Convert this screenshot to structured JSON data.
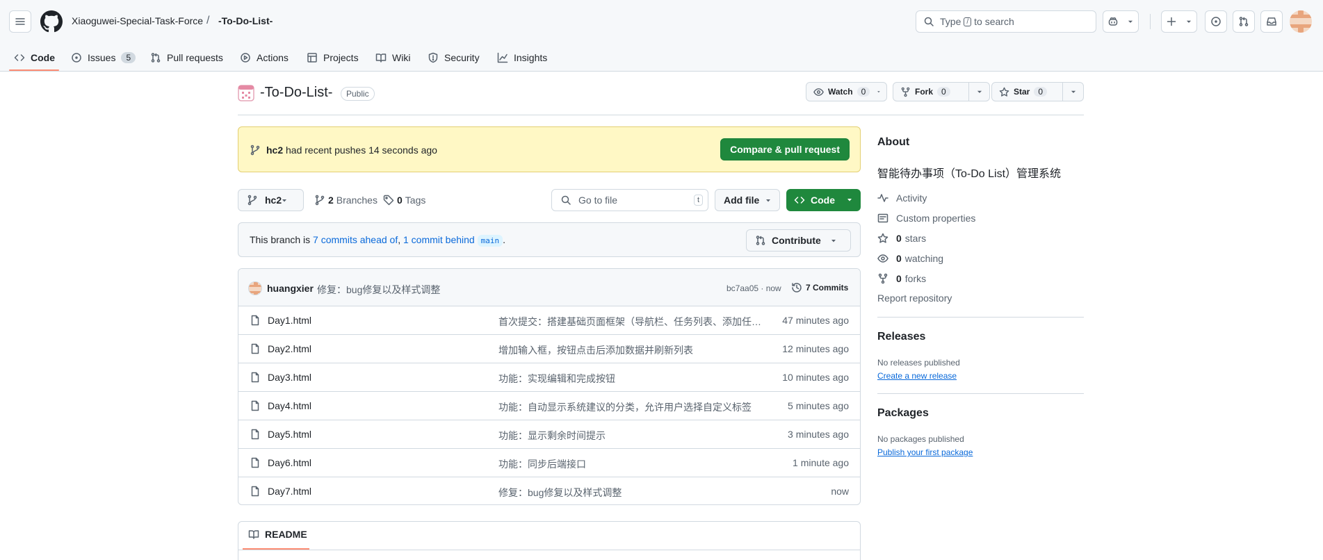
{
  "header": {
    "owner": "Xiaoguwei-Special-Task-Force",
    "separator": "/",
    "repo": "-To-Do-List-",
    "search_pre": "Type",
    "search_key": "/",
    "search_post": "to search",
    "icons": [
      "hamburger-icon",
      "github-logo",
      "search-icon",
      "copilot-icon",
      "plus-icon",
      "issue-icon",
      "pull-request-icon",
      "inbox-icon"
    ]
  },
  "tabs": [
    {
      "label": "Code",
      "icon": "code-icon"
    },
    {
      "label": "Issues",
      "icon": "issue-icon",
      "count": "5"
    },
    {
      "label": "Pull requests",
      "icon": "pull-request-icon"
    },
    {
      "label": "Actions",
      "icon": "play-icon"
    },
    {
      "label": "Projects",
      "icon": "table-icon"
    },
    {
      "label": "Wiki",
      "icon": "book-icon"
    },
    {
      "label": "Security",
      "icon": "shield-icon"
    },
    {
      "label": "Insights",
      "icon": "graph-icon"
    }
  ],
  "repo": {
    "title": "-To-Do-List-",
    "visibility": "Public",
    "watch_label": "Watch",
    "watch_count": "0",
    "fork_label": "Fork",
    "fork_count": "0",
    "star_label": "Star",
    "star_count": "0"
  },
  "push_banner": {
    "branch": "hc2",
    "text": "had recent pushes 14 seconds ago",
    "button": "Compare & pull request"
  },
  "branch_bar": {
    "current_branch": "hc2",
    "branches_count": "2",
    "branches_label": "Branches",
    "tags_count": "0",
    "tags_label": "Tags",
    "goto_placeholder": "Go to file",
    "goto_key": "t",
    "add_file": "Add file",
    "code_button": "Code"
  },
  "ahead_behind": {
    "prefix": "This branch is",
    "ahead": "7 commits ahead of",
    "comma": ",",
    "behind": "1 commit behind",
    "base": "main",
    "suffix": ".",
    "contribute": "Contribute"
  },
  "latest_commit": {
    "author": "huangxier",
    "message": "修复：bug修复以及样式调整",
    "hash_time": "bc7aa05 · now",
    "commits": "7 Commits"
  },
  "files": [
    {
      "name": "Day1.html",
      "message": "首次提交：搭建基础页面框架（导航栏、任务列表、添加任务按钮）",
      "date": "47 minutes ago"
    },
    {
      "name": "Day2.html",
      "message": "增加输入框，按钮点击后添加数据并刷新列表",
      "date": "12 minutes ago"
    },
    {
      "name": "Day3.html",
      "message": "功能：实现编辑和完成按钮",
      "date": "10 minutes ago"
    },
    {
      "name": "Day4.html",
      "message": "功能：自动显示系统建议的分类，允许用户选择自定义标签",
      "date": "5 minutes ago"
    },
    {
      "name": "Day5.html",
      "message": "功能：显示剩余时间提示",
      "date": "3 minutes ago"
    },
    {
      "name": "Day6.html",
      "message": "功能：同步后端接口",
      "date": "1 minute ago"
    },
    {
      "name": "Day7.html",
      "message": "修复：bug修复以及样式调整",
      "date": "now"
    }
  ],
  "readme": {
    "label": "README"
  },
  "about": {
    "title": "About",
    "description": "智能待办事项（To-Do List）管理系统",
    "activity": "Activity",
    "custom_properties": "Custom properties",
    "stars_count": "0",
    "stars_label": "stars",
    "watching_count": "0",
    "watching_label": "watching",
    "forks_count": "0",
    "forks_label": "forks",
    "report": "Report repository"
  },
  "releases": {
    "title": "Releases",
    "none": "No releases published",
    "link": "Create a new release"
  },
  "packages": {
    "title": "Packages",
    "none": "No packages published",
    "link": "Publish your first package"
  },
  "colors": {
    "primary_green": "#1f883d",
    "link_blue": "#0969da",
    "tab_underline": "#fd8c73",
    "banner_bg": "#fff8c5"
  }
}
